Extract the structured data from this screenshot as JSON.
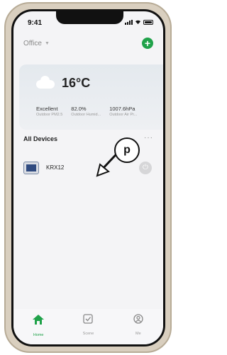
{
  "status_bar": {
    "time": "9:41"
  },
  "header": {
    "home_name": "Office",
    "chevron_icon": "chevron-down-icon",
    "add_icon": "plus-icon"
  },
  "weather": {
    "temperature": "16°C",
    "metrics": [
      {
        "value": "Excellent",
        "label": "Outdoor PM2.5"
      },
      {
        "value": "82.0%",
        "label": "Outdoor Humid..."
      },
      {
        "value": "1007.6hPa",
        "label": "Outdoor Air Pr..."
      }
    ]
  },
  "devices_section": {
    "title": "All Devices",
    "more": "···"
  },
  "devices": [
    {
      "name": "KRX12"
    }
  ],
  "annotation": {
    "letter": "p"
  },
  "tabs": [
    {
      "label": "Home",
      "active": true
    },
    {
      "label": "Scene",
      "active": false
    },
    {
      "label": "Me",
      "active": false
    }
  ],
  "colors": {
    "accent": "#20a24a"
  }
}
